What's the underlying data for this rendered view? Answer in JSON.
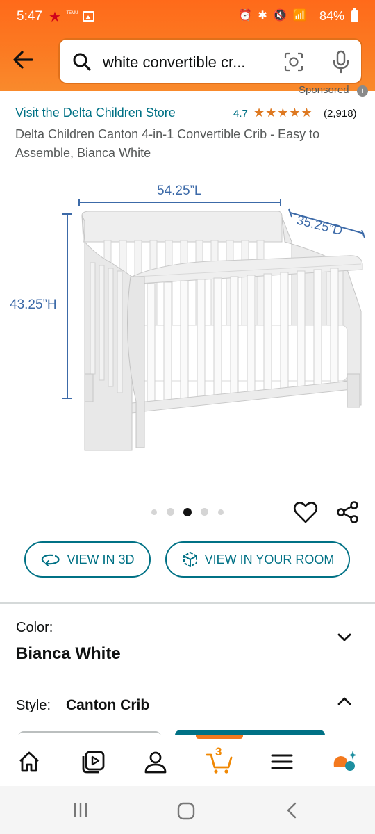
{
  "status_bar": {
    "time": "5:47",
    "temu_text": "TEMU",
    "system_icons": "⏰ ✱ 🔇 📶",
    "battery": "84%"
  },
  "search": {
    "query": "white convertible cr..."
  },
  "product": {
    "sponsored": "Sponsored",
    "store_link": "Visit the Delta Children Store",
    "rating": "4.7",
    "stars": "★★★★★",
    "review_count": "(2,918)",
    "title": "Delta Children Canton 4-in-1 Convertible Crib - Easy to Assemble, Bianca White"
  },
  "image": {
    "length": "54.25”L",
    "depth": "35.25”D",
    "height": "43.25”H",
    "dot_count": 5,
    "active_dot": 2
  },
  "actions": {
    "view_3d": "VIEW IN 3D",
    "view_room": "VIEW IN YOUR ROOM"
  },
  "color": {
    "label": "Color:",
    "value": "Bianca White"
  },
  "style": {
    "label": "Style:",
    "value": "Canton Crib"
  },
  "bottom_nav": {
    "cart_count": "3",
    "items": [
      "home-icon",
      "video-icon",
      "account-icon",
      "cart-icon",
      "menu-icon",
      "rufus-icon"
    ]
  },
  "colors": {
    "header": "#ff6a1a",
    "link": "#007185",
    "stars": "#de7921",
    "dimension": "#3c6aa8"
  }
}
